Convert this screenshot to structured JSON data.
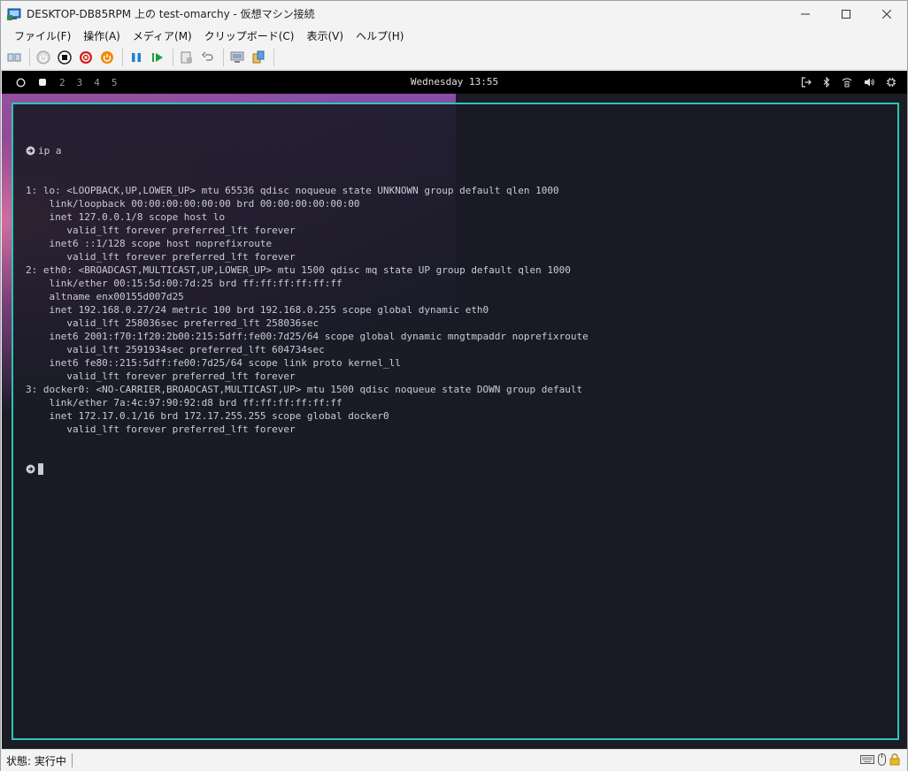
{
  "window": {
    "title": "DESKTOP-DB85RPM 上の test-omarchy  - 仮想マシン接続"
  },
  "menu": [
    "ファイル(F)",
    "操作(A)",
    "メディア(M)",
    "クリップボード(C)",
    "表示(V)",
    "ヘルプ(H)"
  ],
  "toolbar": {
    "buttons": [
      "ctrl-alt-del-icon",
      "start-icon",
      "turn-off-icon",
      "shutdown-icon",
      "power-icon",
      "pause-icon",
      "reset-icon",
      "checkpoint-icon",
      "revert-icon",
      "enhanced-session-icon",
      "share-icon"
    ]
  },
  "waybar": {
    "workspaces": [
      "2",
      "3",
      "4",
      "5"
    ],
    "clock": "Wednesday 13:55"
  },
  "terminal": {
    "command": "ip a",
    "lines": [
      "1: lo: <LOOPBACK,UP,LOWER_UP> mtu 65536 qdisc noqueue state UNKNOWN group default qlen 1000",
      "    link/loopback 00:00:00:00:00:00 brd 00:00:00:00:00:00",
      "    inet 127.0.0.1/8 scope host lo",
      "       valid_lft forever preferred_lft forever",
      "    inet6 ::1/128 scope host noprefixroute",
      "       valid_lft forever preferred_lft forever",
      "2: eth0: <BROADCAST,MULTICAST,UP,LOWER_UP> mtu 1500 qdisc mq state UP group default qlen 1000",
      "    link/ether 00:15:5d:00:7d:25 brd ff:ff:ff:ff:ff:ff",
      "    altname enx00155d007d25",
      "    inet 192.168.0.27/24 metric 100 brd 192.168.0.255 scope global dynamic eth0",
      "       valid_lft 258036sec preferred_lft 258036sec",
      "    inet6 2001:f70:1f20:2b00:215:5dff:fe00:7d25/64 scope global dynamic mngtmpaddr noprefixroute",
      "       valid_lft 2591934sec preferred_lft 604734sec",
      "    inet6 fe80::215:5dff:fe00:7d25/64 scope link proto kernel_ll",
      "       valid_lft forever preferred_lft forever",
      "3: docker0: <NO-CARRIER,BROADCAST,MULTICAST,UP> mtu 1500 qdisc noqueue state DOWN group default",
      "    link/ether 7a:4c:97:90:92:d8 brd ff:ff:ff:ff:ff:ff",
      "    inet 172.17.0.1/16 brd 172.17.255.255 scope global docker0",
      "       valid_lft forever preferred_lft forever"
    ]
  },
  "status": {
    "text": "状態: 実行中"
  },
  "colors": {
    "terminal_border": "#2ec4b6",
    "terminal_bg": "#1a1b26",
    "terminal_text": "#c9ccd6"
  }
}
